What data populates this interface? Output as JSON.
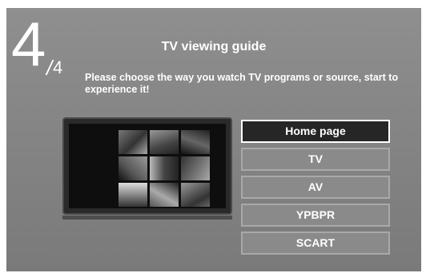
{
  "step": {
    "current": "4",
    "separator": "/",
    "total": "4"
  },
  "title": "TV viewing guide",
  "description": "Please choose the way you watch TV programs or source, start to experience it!",
  "preview": {
    "icon": "tv-preview-image"
  },
  "menu": {
    "items": [
      {
        "label": "Home page",
        "selected": true
      },
      {
        "label": "TV",
        "selected": false
      },
      {
        "label": "AV",
        "selected": false
      },
      {
        "label": "YPBPR",
        "selected": false
      },
      {
        "label": "SCART",
        "selected": false
      }
    ]
  },
  "colors": {
    "background": "#858585",
    "selected_item": "#262626",
    "item": "#8a8a8a",
    "text": "#ffffff"
  }
}
